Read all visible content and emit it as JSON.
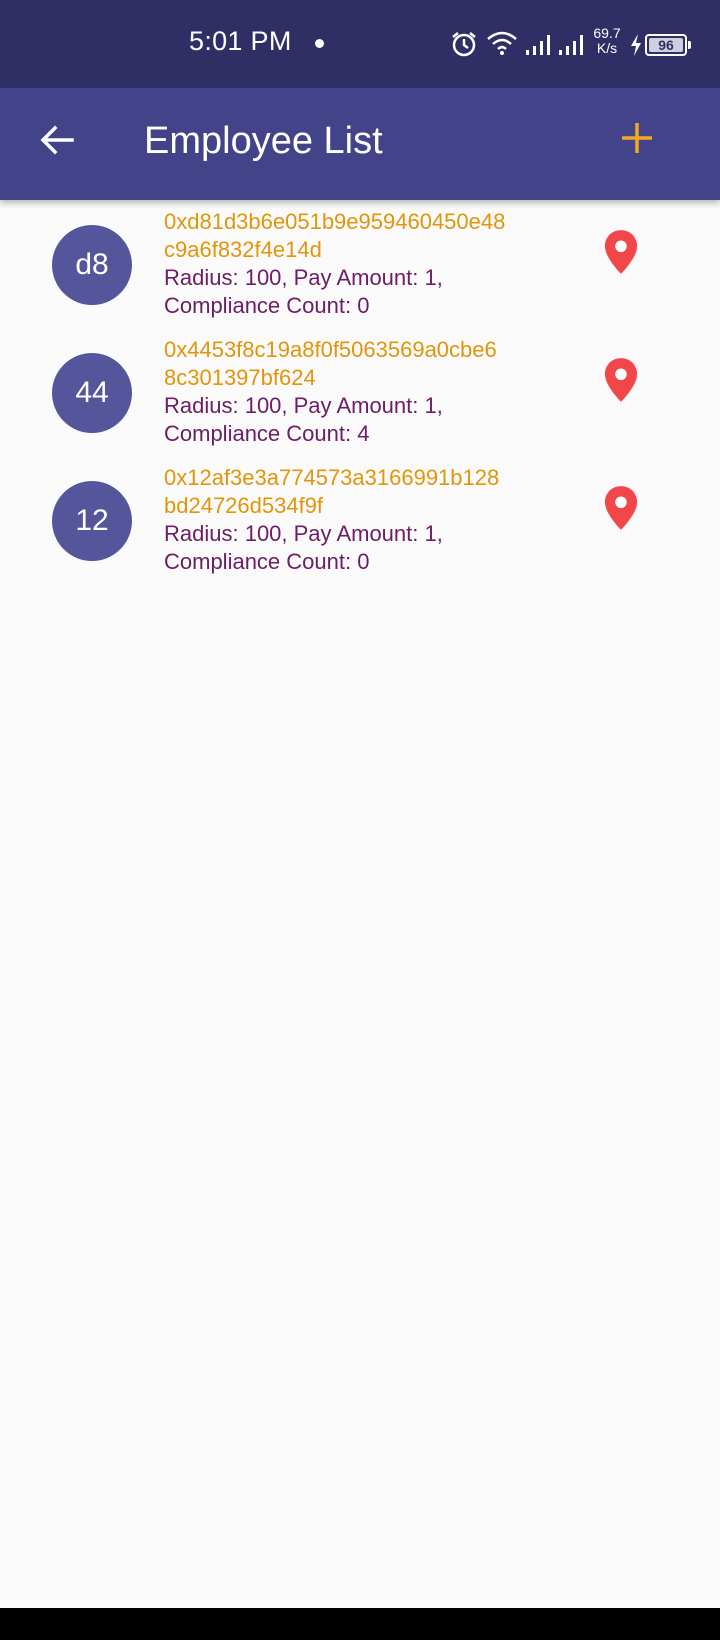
{
  "status_bar": {
    "time": "5:01 PM",
    "net_speed_value": "69.7",
    "net_speed_unit": "K/s",
    "battery_level": "96",
    "icons": [
      "alarm-icon",
      "wifi-icon",
      "signal-icon",
      "signal-icon",
      "charging-bolt-icon",
      "battery-icon"
    ]
  },
  "app_bar": {
    "title": "Employee List",
    "back_icon": "arrow-left-icon",
    "add_icon": "plus-icon",
    "colors": {
      "background": "#434389",
      "title": "#ffffff",
      "add": "#f5a623"
    }
  },
  "employees": [
    {
      "avatar": "d8",
      "address_line1": "0xd81d3b6e051b9e959460450e48",
      "address_line2": "c9a6f832f4e14d",
      "details_line1": "Radius: 100, Pay Amount: 1,",
      "details_line2": "Compliance Count: 0",
      "action_icon": "location-pin-icon"
    },
    {
      "avatar": "44",
      "address_line1": "0x4453f8c19a8f0f5063569a0cbe6",
      "address_line2": "8c301397bf624",
      "details_line1": "Radius: 100, Pay Amount: 1,",
      "details_line2": "Compliance Count: 4",
      "action_icon": "location-pin-icon"
    },
    {
      "avatar": "12",
      "address_line1": "0x12af3e3a774573a3166991b128",
      "address_line2": "bd24726d534f9f",
      "details_line1": "Radius: 100, Pay Amount: 1,",
      "details_line2": "Compliance Count: 0",
      "action_icon": "location-pin-icon"
    }
  ],
  "colors": {
    "avatar": "#55559b",
    "address": "#e0960b",
    "details": "#6b1e63",
    "pin": "#f2474a",
    "background": "#fafafa"
  }
}
